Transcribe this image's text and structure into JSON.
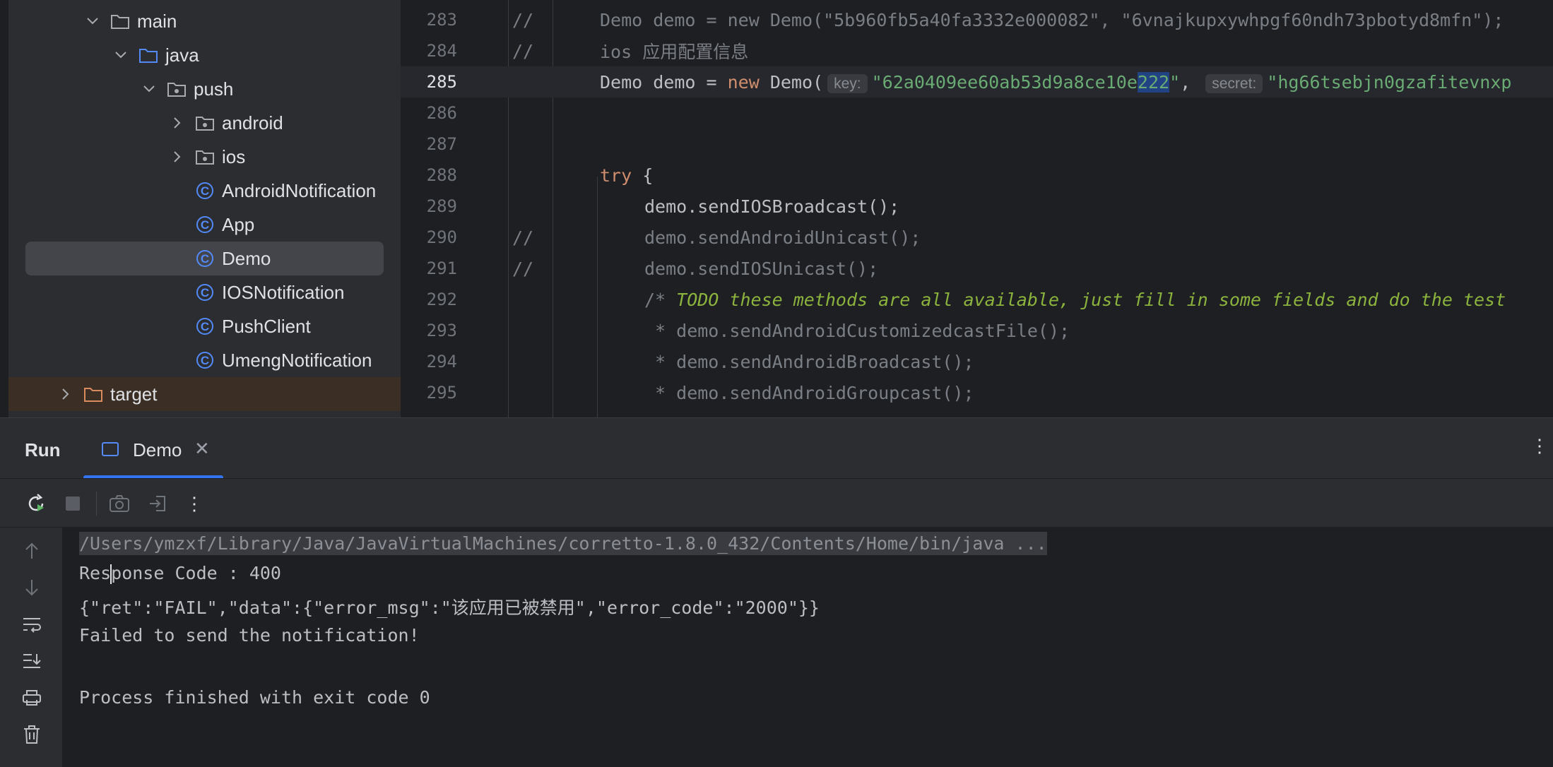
{
  "tree": {
    "items": [
      {
        "label": "main",
        "icon": "folder-icon",
        "expanded": true
      },
      {
        "label": "java",
        "icon": "source-folder-icon",
        "expanded": true
      },
      {
        "label": "push",
        "icon": "package-icon",
        "expanded": true
      },
      {
        "label": "android",
        "icon": "package-icon",
        "expanded": false
      },
      {
        "label": "ios",
        "icon": "package-icon",
        "expanded": false
      },
      {
        "label": "AndroidNotification",
        "icon": "class-icon"
      },
      {
        "label": "App",
        "icon": "class-icon"
      },
      {
        "label": "Demo",
        "icon": "runnable-class-icon",
        "selected": true
      },
      {
        "label": "IOSNotification",
        "icon": "class-icon"
      },
      {
        "label": "PushClient",
        "icon": "class-icon"
      },
      {
        "label": "UmengNotification",
        "icon": "class-icon"
      },
      {
        "label": "target",
        "icon": "excluded-folder-icon",
        "expanded": false
      }
    ]
  },
  "editor": {
    "lines": [
      {
        "num": "283",
        "comment_mark": "//",
        "text": "Demo demo = new Demo(\"5b960fb5a40fa3332e000082\", \"6vnajkupxywhpgf60ndh73pbotyd8mfn\");"
      },
      {
        "num": "284",
        "comment_mark": "//",
        "text": "ios 应用配置信息"
      },
      {
        "num": "285",
        "pre": "Demo demo = ",
        "kw_new": "new",
        "call": " Demo(",
        "hint_key": "key:",
        "str_key_a": "\"62a0409ee60ab53d9a8ce10e",
        "str_key_sel": "222",
        "str_key_b": "\"",
        "comma": ",",
        "hint_secret": "secret:",
        "str_secret": "\"hg66tsebjn0gzafitevnxp"
      },
      {
        "num": "286",
        "text": ""
      },
      {
        "num": "287",
        "text": ""
      },
      {
        "num": "288",
        "kw_try": "try",
        "rest": " {"
      },
      {
        "num": "289",
        "text": "demo.sendIOSBroadcast();"
      },
      {
        "num": "290",
        "comment_mark": "//",
        "text": "demo.sendAndroidUnicast();"
      },
      {
        "num": "291",
        "comment_mark": "//",
        "text": "demo.sendIOSUnicast();"
      },
      {
        "num": "292",
        "open": "/* ",
        "todo": "TODO these methods are all available, just fill in some fields and do the test"
      },
      {
        "num": "293",
        "text": " * demo.sendAndroidCustomizedcastFile();"
      },
      {
        "num": "294",
        "text": " * demo.sendAndroidBroadcast();"
      },
      {
        "num": "295",
        "text": " * demo.sendAndroidGroupcast();"
      }
    ]
  },
  "run": {
    "title": "Run",
    "tab_label": "Demo",
    "console": {
      "path": "/Users/ymzxf/Library/Java/JavaVirtualMachines/corretto-1.8.0_432/Contents/Home/bin/java ...",
      "line1_a": "Res",
      "line1_b": "ponse Code : 400",
      "line2": "{\"ret\":\"FAIL\",\"data\":{\"error_msg\":\"该应用已被禁用\",\"error_code\":\"2000\"}}",
      "line3": "Failed to send the notification!",
      "line4": "Process finished with exit code 0"
    }
  },
  "colors": {
    "accent": "#3574f0",
    "keyword": "#cf8e6d",
    "string": "#6aab73",
    "comment": "#7a7e85",
    "todo": "#8bb33d"
  }
}
